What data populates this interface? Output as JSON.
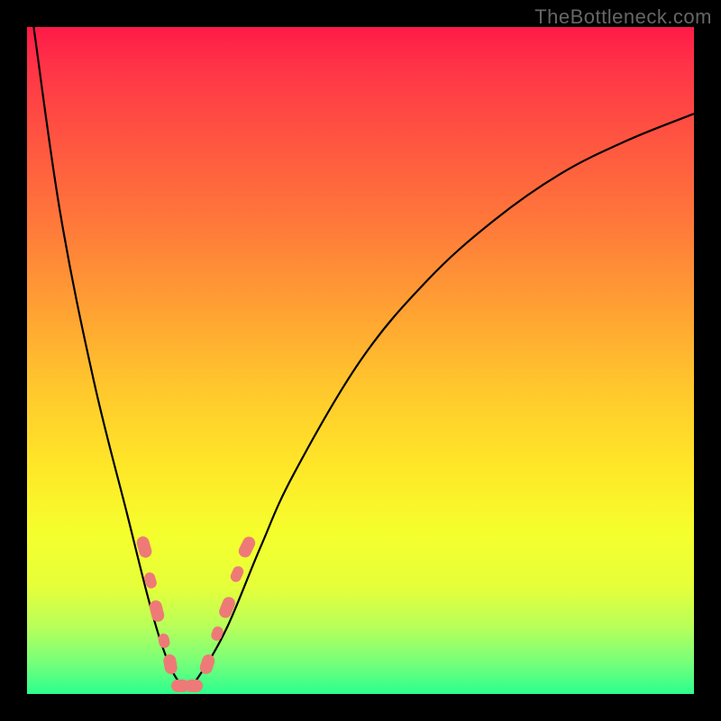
{
  "watermark": "TheBottleneck.com",
  "chart_data": {
    "type": "line",
    "title": "",
    "xlabel": "",
    "ylabel": "",
    "xlim": [
      0,
      100
    ],
    "ylim": [
      0,
      100
    ],
    "grid": false,
    "legend": false,
    "series": [
      {
        "name": "bottleneck-curve",
        "x": [
          1,
          5,
          10,
          15,
          18,
          20,
          22,
          24,
          26,
          30,
          35,
          40,
          50,
          60,
          70,
          80,
          90,
          100
        ],
        "values": [
          100,
          72,
          47,
          27,
          15,
          8,
          3,
          1,
          3,
          10,
          22,
          33,
          50,
          62,
          71,
          78,
          83,
          87
        ]
      }
    ],
    "markers": [
      {
        "x": 17.5,
        "y": 22,
        "w": 14,
        "h": 24,
        "rot": -16
      },
      {
        "x": 18.5,
        "y": 17,
        "w": 12,
        "h": 18,
        "rot": -16
      },
      {
        "x": 19.5,
        "y": 12.5,
        "w": 14,
        "h": 24,
        "rot": -14
      },
      {
        "x": 20.5,
        "y": 8,
        "w": 12,
        "h": 16,
        "rot": -12
      },
      {
        "x": 21.5,
        "y": 4.5,
        "w": 14,
        "h": 22,
        "rot": -10
      },
      {
        "x": 23,
        "y": 1.2,
        "w": 20,
        "h": 14,
        "rot": 0
      },
      {
        "x": 25,
        "y": 1.2,
        "w": 20,
        "h": 14,
        "rot": 0
      },
      {
        "x": 27,
        "y": 4.5,
        "w": 14,
        "h": 22,
        "rot": 18
      },
      {
        "x": 28.5,
        "y": 9,
        "w": 12,
        "h": 16,
        "rot": 20
      },
      {
        "x": 30,
        "y": 13,
        "w": 14,
        "h": 24,
        "rot": 22
      },
      {
        "x": 31.5,
        "y": 18,
        "w": 12,
        "h": 18,
        "rot": 24
      },
      {
        "x": 33,
        "y": 22,
        "w": 14,
        "h": 24,
        "rot": 26
      }
    ]
  },
  "colors": {
    "curve": "#000000",
    "marker": "#ee7a77",
    "frame": "#000000"
  }
}
